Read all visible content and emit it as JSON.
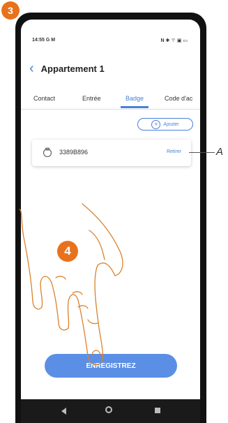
{
  "step_badges": {
    "first": "3",
    "second": "4"
  },
  "status_bar": {
    "time": "14:55 G M",
    "icons": "N ✱ ⌔ ▣ ▭"
  },
  "header": {
    "back_icon": "chevron-left-icon",
    "title": "Appartement 1"
  },
  "tabs": [
    {
      "label": "Contact",
      "active": false
    },
    {
      "label": "Entrée",
      "active": false
    },
    {
      "label": "Badge",
      "active": true
    },
    {
      "label": "Code d'ac",
      "active": false
    }
  ],
  "add_button": {
    "icon": "plus-circle-icon",
    "label": "Ajouter"
  },
  "badge_item": {
    "icon": "badge-tag-icon",
    "code": "3389B896",
    "remove_label": "Retirer"
  },
  "save_button": {
    "label": "ENREGISTREZ"
  },
  "callout": {
    "label": "A"
  },
  "colors": {
    "accent": "#4a7fd6",
    "button": "#5b8fe6",
    "step_badge": "#e8721c",
    "hand_outline": "#d9822b"
  }
}
